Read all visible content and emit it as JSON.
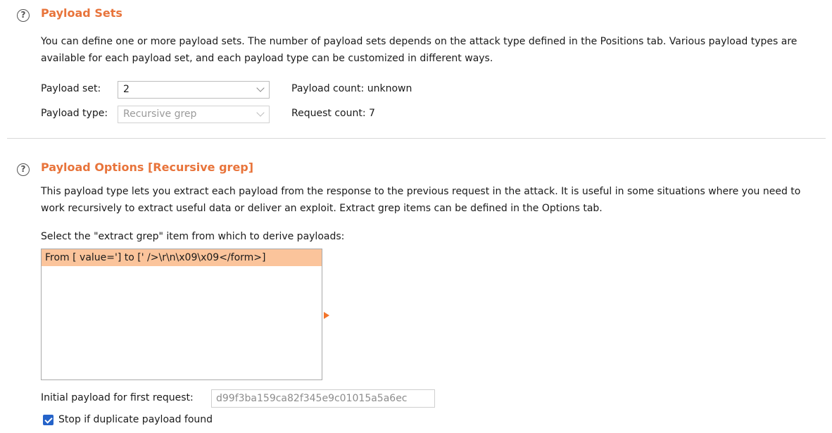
{
  "payload_sets": {
    "title": "Payload Sets",
    "description": "You can define one or more payload sets. The number of payload sets depends on the attack type defined in the Positions tab. Various payload types are available for each payload set, and each payload type can be customized in different ways.",
    "payload_set_label": "Payload set:",
    "payload_set_value": "2",
    "payload_type_label": "Payload type:",
    "payload_type_value": "Recursive grep",
    "payload_count": "Payload count: unknown",
    "request_count": "Request count: 7"
  },
  "payload_options": {
    "title": "Payload Options [Recursive grep]",
    "description": "This payload type lets you extract each payload from the response to the previous request in the attack. It is useful in some situations where you need to work recursively to extract useful data or deliver an exploit. Extract grep items can be defined in the Options tab.",
    "select_label": "Select the \"extract grep\" item from which to derive payloads:",
    "items": [
      "From [ value='] to [' />\\r\\n\\x09\\x09</form>]"
    ],
    "initial_payload_label": "Initial payload for first request:",
    "initial_payload_value": "d99f3ba159ca82f345e9c01015a5a6ec",
    "stop_duplicate_label": "Stop if duplicate payload found",
    "stop_duplicate_checked": true
  },
  "icons": {
    "help": "help-circle-icon",
    "arrow": "expand-arrow-icon",
    "dropdown": "chevron-down-icon",
    "check": "check-icon"
  },
  "colors": {
    "title": "#e8743b",
    "selection": "#fbc49b",
    "arrow": "#f2742b",
    "checkbox": "#2563c9"
  }
}
